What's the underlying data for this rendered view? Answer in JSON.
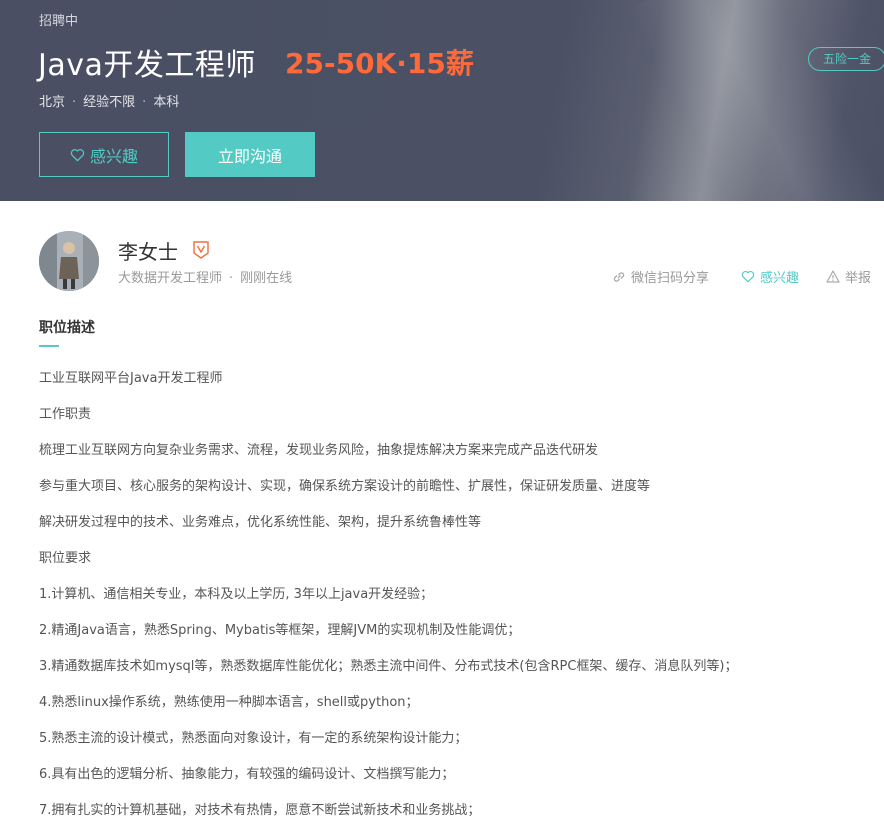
{
  "header": {
    "status": "招聘中",
    "job_title": "Java开发工程师",
    "salary": "25-50K·15薪",
    "benefit_badge": "五险一金",
    "meta": [
      "北京",
      "经验不限",
      "本科"
    ],
    "buttons": {
      "interest": "感兴趣",
      "chat": "立即沟通"
    }
  },
  "recruiter": {
    "name": "李女士",
    "title": "大数据开发工程师",
    "online_status": "刚刚在线"
  },
  "actions": {
    "share": "微信扫码分享",
    "favorite": "感兴趣",
    "report": "举报"
  },
  "description": {
    "section_title": "职位描述",
    "lines": [
      "工业互联网平台Java开发工程师",
      "工作职责",
      "梳理工业互联网方向复杂业务需求、流程，发现业务风险，抽象提炼解决方案来完成产品迭代研发",
      "参与重大项目、核心服务的架构设计、实现，确保系统方案设计的前瞻性、扩展性，保证研发质量、进度等",
      "解决研发过程中的技术、业务难点，优化系统性能、架构，提升系统鲁棒性等",
      "职位要求",
      "1.计算机、通信相关专业，本科及以上学历, 3年以上java开发经验；",
      "2.精通Java语言，熟悉Spring、Mybatis等框架，理解JVM的实现机制及性能调优；",
      "3.精通数据库技术如mysql等，熟悉数据库性能优化；熟悉主流中间件、分布式技术(包含RPC框架、缓存、消息队列等)；",
      "4.熟悉linux操作系统，熟练使用一种脚本语言，shell或python；",
      "5.熟悉主流的设计模式，熟悉面向对象设计，有一定的系统架构设计能力；",
      "6.具有出色的逻辑分析、抽象能力，有较强的编码设计、文档撰写能力；",
      "7.拥有扎实的计算机基础，对技术有热情，愿意不断尝试新技术和业务挑战；"
    ]
  },
  "colors": {
    "banner_bg": "#4b5064",
    "accent": "#53cac3",
    "salary": "#fe6a3a",
    "verify": "#f26d3d"
  },
  "icons": {
    "interest": "heart-outline-icon",
    "share": "link-icon",
    "favorite": "heart-outline-icon",
    "report": "warning-triangle-icon",
    "verify": "v-badge-icon"
  }
}
